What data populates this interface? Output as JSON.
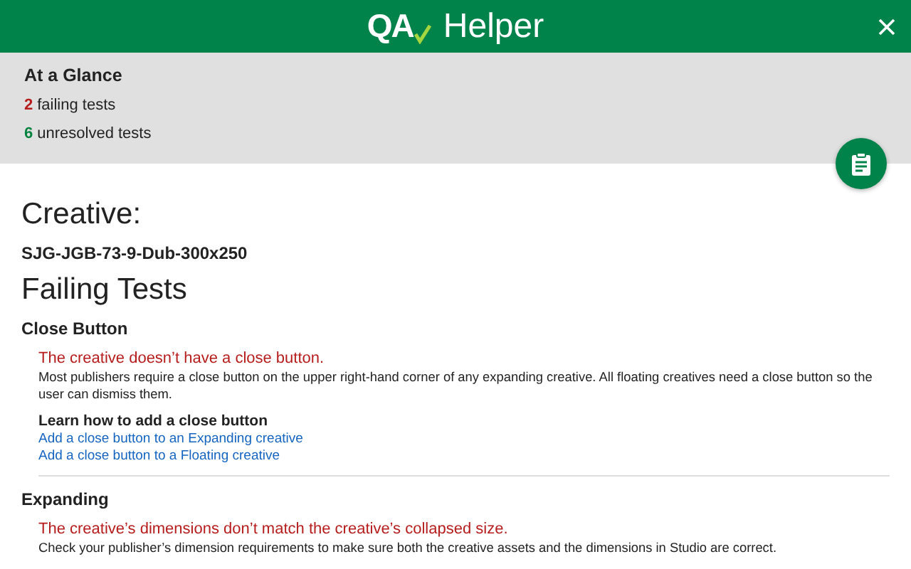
{
  "header": {
    "logo": "QA",
    "title": "Helper"
  },
  "glance": {
    "title": "At a Glance",
    "stats": [
      {
        "count": "2",
        "label": "failing tests",
        "kind": "failing"
      },
      {
        "count": "6",
        "label": "unresolved tests",
        "kind": "unresolved"
      }
    ]
  },
  "creative": {
    "label": "Creative:",
    "name": "SJG-JGB-73-9-Dub-300x250"
  },
  "failing": {
    "heading": "Failing Tests",
    "tests": [
      {
        "title": "Close Button",
        "message": "The creative doesn’t have a close button.",
        "description": "Most publishers require a close button on the upper right-hand corner of any expanding creative. All floating creatives need a close button so the user can dismiss them.",
        "learn": {
          "title": "Learn how to add a close button",
          "links": [
            "Add a close button to an Expanding creative",
            "Add a close button to a Floating creative"
          ]
        }
      },
      {
        "title": "Expanding",
        "message": "The creative’s dimensions don’t match the creative’s collapsed size.",
        "description": "Check your publisher’s dimension requirements to make sure both the creative assets and the dimensions in Studio are correct."
      }
    ]
  }
}
